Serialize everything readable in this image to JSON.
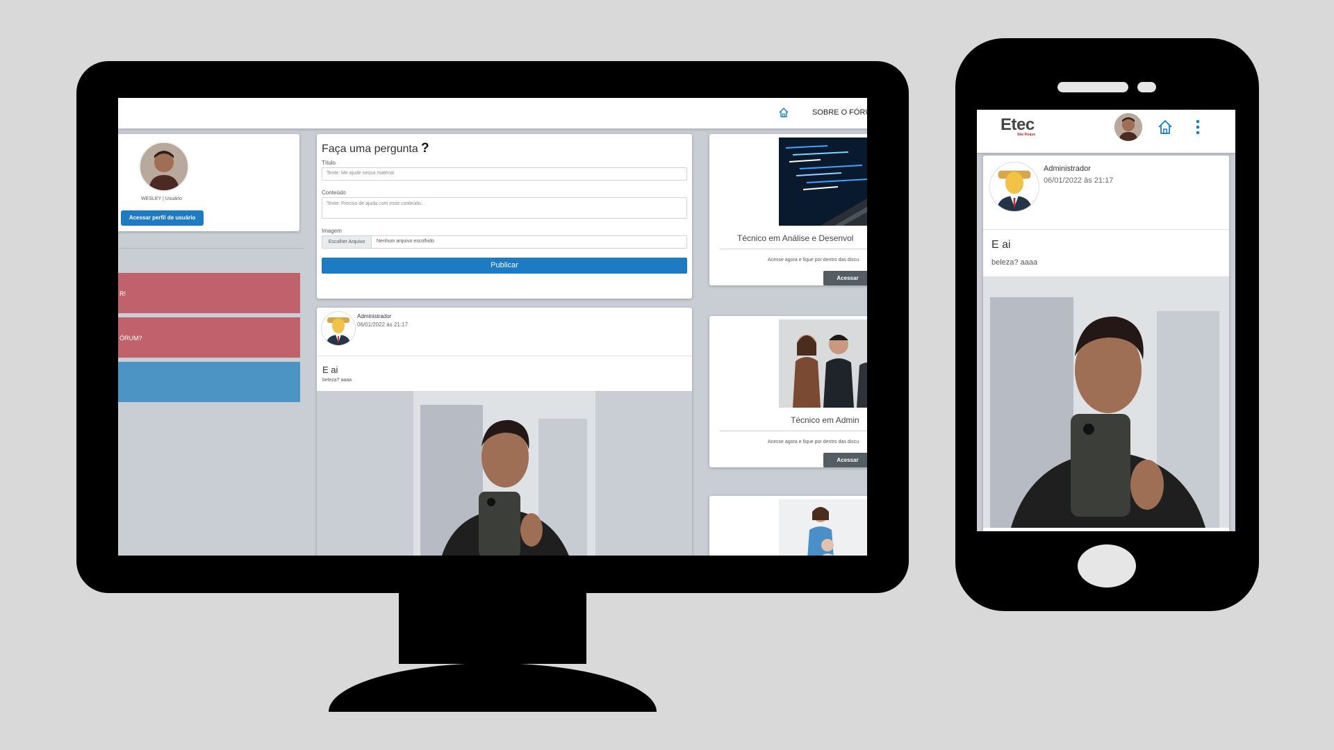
{
  "desktop": {
    "nav": {
      "about_label": "SOBRE O FÓRUM"
    },
    "profile": {
      "user_label": "WESLEY | Usuário",
      "button_label": "Acessar perfil de usuário"
    },
    "sidebar": {
      "item1_label": "R!",
      "item2_label": "ÓRUM?",
      "item3_label": ""
    },
    "ask_form": {
      "title": "Faça uma pergunta",
      "title_icon": "?",
      "titulo_label": "Título",
      "titulo_placeholder": "Tente: Me ajude nessa matéria!",
      "conteudo_label": "Conteúdo",
      "conteudo_placeholder": "Tente: Preciso de ajuda com esse conteúdo...",
      "imagem_label": "Imagem",
      "file_button": "Escolher Arquivo",
      "file_status": "Nenhum arquivo escolhido",
      "publish_label": "Publicar"
    },
    "post": {
      "author": "Administrador",
      "date": "06/01/2022 às 21:17",
      "title": "E ai",
      "body": "beleza? aaaa"
    },
    "courses": [
      {
        "title": "Técnico em Análise e Desenvol",
        "desc": "Acesse agora e fique por dentro das discu",
        "button": "Acessar"
      },
      {
        "title": "Técnico em Admin",
        "desc": "Acesse agora e fique por dentro das discu",
        "button": "Acessar"
      }
    ],
    "colors": {
      "primary": "#1c7bc3",
      "sidebar_red": "#c1616b",
      "sidebar_blue": "#4b94c4"
    }
  },
  "mobile": {
    "logo": "Etec",
    "logo_sub": "São Roque",
    "post": {
      "author": "Administrador",
      "date": "06/01/2022 às 21:17",
      "title": "E ai",
      "body": "beleza? aaaa"
    }
  }
}
